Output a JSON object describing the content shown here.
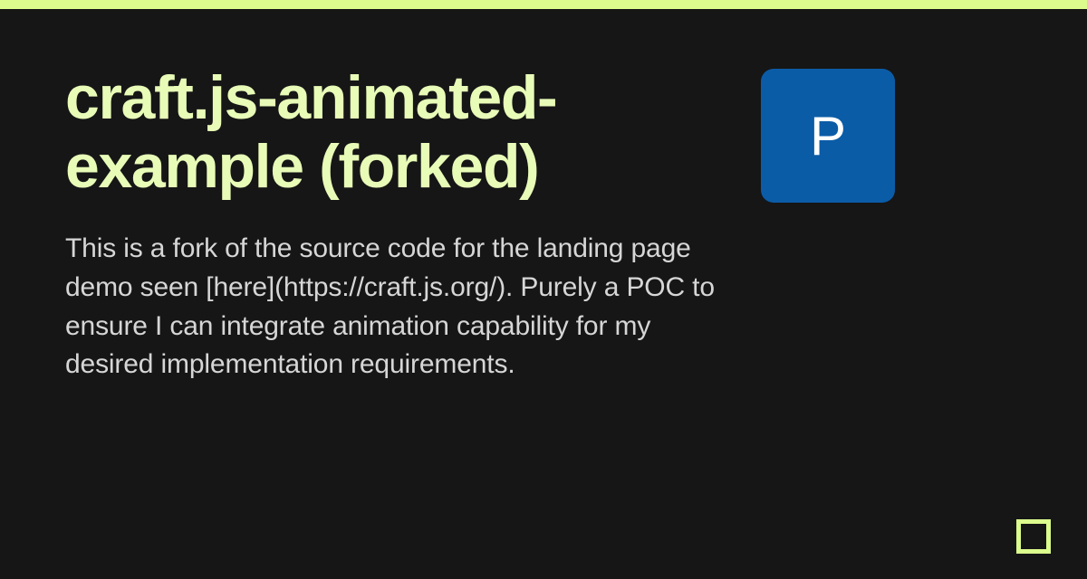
{
  "colors": {
    "accent": "#dcfc8d",
    "titleText": "#e8fcb8",
    "bodyText": "#d6d6d6",
    "background": "#161616",
    "avatarBg": "#0b5ca7",
    "avatarFg": "#ffffff"
  },
  "header": {
    "title": "craft.js-animated-example (forked)",
    "description": "This is a fork of the source code for the landing page demo seen [here](https://craft.js.org/). Purely a POC to ensure I can integrate animation capability for my desired implementation requirements."
  },
  "avatar": {
    "letter": "P"
  }
}
